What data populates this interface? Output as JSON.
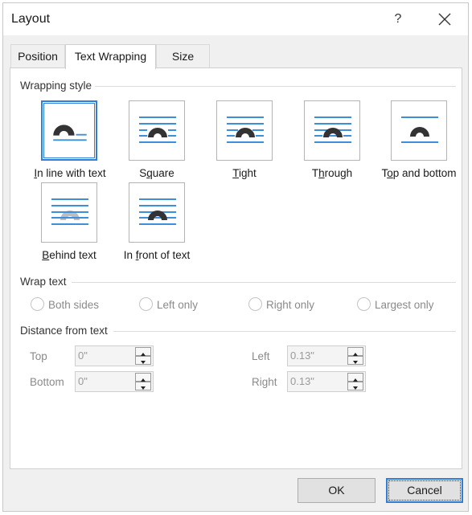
{
  "window": {
    "title": "Layout",
    "help_label": "?"
  },
  "tabs": [
    {
      "label": "Position",
      "active": false
    },
    {
      "label": "Text Wrapping",
      "active": true
    },
    {
      "label": "Size",
      "active": false
    }
  ],
  "wrapping_style": {
    "heading": "Wrapping style",
    "selected": "In line with text",
    "options": [
      {
        "before": "",
        "key": "I",
        "after": "n line with text",
        "icon": "inline-wrap-icon"
      },
      {
        "before": "S",
        "key": "q",
        "after": "uare",
        "icon": "square-wrap-icon"
      },
      {
        "before": "",
        "key": "T",
        "after": "ight",
        "icon": "tight-wrap-icon"
      },
      {
        "before": "T",
        "key": "h",
        "after": "rough",
        "icon": "through-wrap-icon"
      },
      {
        "before": "T",
        "key": "o",
        "after": "p and bottom",
        "icon": "top-bottom-wrap-icon"
      },
      {
        "before": "",
        "key": "B",
        "after": "ehind text",
        "icon": "behind-text-wrap-icon"
      },
      {
        "before": "In ",
        "key": "f",
        "after": "ront of text",
        "icon": "in-front-wrap-icon"
      }
    ]
  },
  "wrap_text": {
    "heading": "Wrap text",
    "enabled": false,
    "options": [
      "Both sides",
      "Left only",
      "Right only",
      "Largest only"
    ]
  },
  "distance": {
    "heading": "Distance from text",
    "top": {
      "label": "Top",
      "value": "0\""
    },
    "bottom": {
      "label": "Bottom",
      "value": "0\""
    },
    "left": {
      "label": "Left",
      "value": "0.13\""
    },
    "right": {
      "label": "Right",
      "value": "0.13\""
    }
  },
  "buttons": {
    "ok": "OK",
    "cancel": "Cancel"
  },
  "colors": {
    "accent": "#2f7fd6",
    "text_line": "#3c8fd8",
    "image_dark": "#333333",
    "image_ghost": "#bdbdbd"
  }
}
